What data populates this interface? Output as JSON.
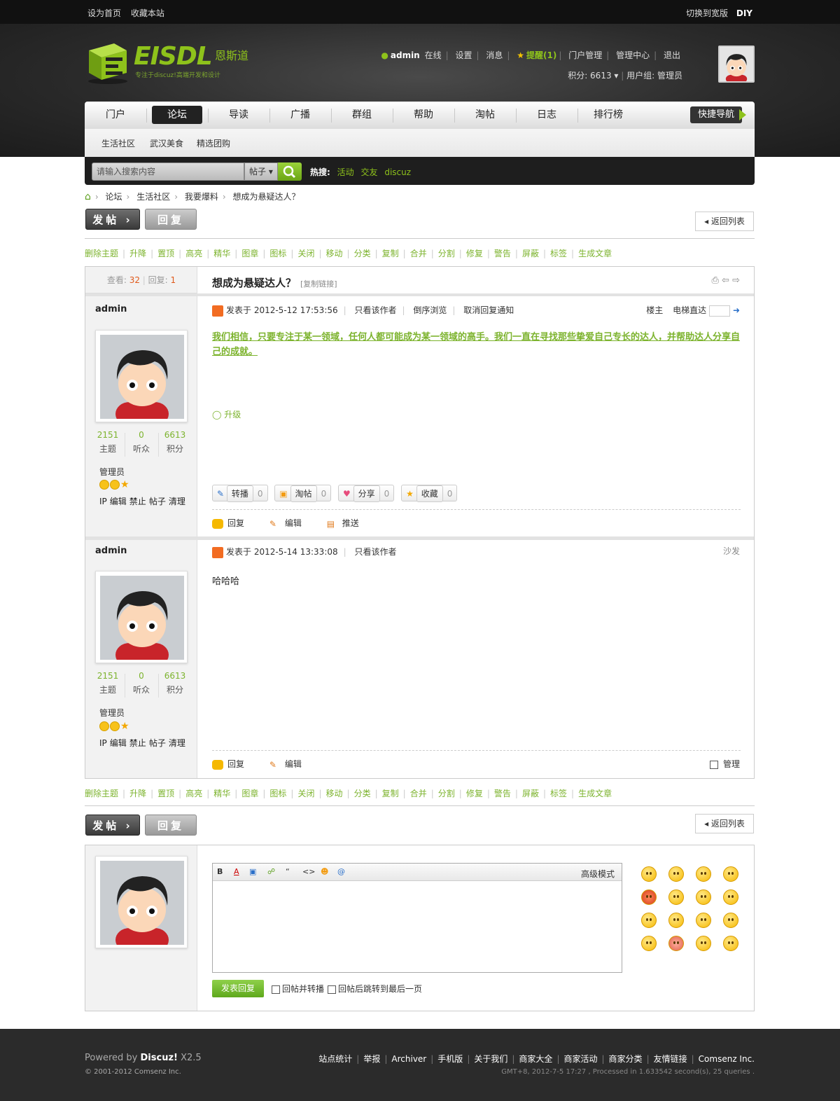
{
  "topbar": {
    "set_home": "设为首页",
    "favorite": "收藏本站",
    "switch_width": "切换到宽版",
    "diy": "DIY"
  },
  "brand": {
    "name": "EISDL",
    "cn_name": "恩斯道",
    "tagline": "专注于discuz!高端开发和设计",
    "accent": "#8ec21b"
  },
  "user": {
    "name": "admin",
    "online": "在线",
    "settings": "设置",
    "messages": "消息",
    "remind": "提醒(1)",
    "portal_manage": "门户管理",
    "admin_center": "管理中心",
    "logout": "退出",
    "credits_label": "积分: 6613",
    "group_label": "用户组: 管理员"
  },
  "nav": {
    "items": [
      "门户",
      "论坛",
      "导读",
      "广播",
      "群组",
      "帮助",
      "淘帖",
      "日志",
      "排行榜"
    ],
    "active": "论坛",
    "quick": "快捷导航"
  },
  "subnav": [
    "生活社区",
    "武汉美食",
    "精选团购"
  ],
  "search": {
    "placeholder": "请输入搜索内容",
    "type": "帖子",
    "hot_label": "热搜:",
    "hot": [
      "活动",
      "交友",
      "discuz"
    ]
  },
  "breadcrumb": [
    "论坛",
    "生活社区",
    "我要爆料",
    "想成为悬疑达人？"
  ],
  "actions": {
    "post": "发帖",
    "reply": "回复",
    "back": "返回列表"
  },
  "modbar": [
    "删除主题",
    "升降",
    "置顶",
    "高亮",
    "精华",
    "图章",
    "图标",
    "关闭",
    "移动",
    "分类",
    "复制",
    "合并",
    "分割",
    "修复",
    "警告",
    "屏蔽",
    "标签",
    "生成文章"
  ],
  "thread": {
    "views_label": "查看:",
    "views": "32",
    "replies_label": "回复:",
    "replies": "1",
    "title": "想成为悬疑达人？",
    "copy_link": "[复制链接]"
  },
  "posts": [
    {
      "author": "admin",
      "stats": [
        {
          "v": "2151",
          "k": "主题"
        },
        {
          "v": "0",
          "k": "听众"
        },
        {
          "v": "6613",
          "k": "积分"
        }
      ],
      "group": "管理员",
      "user_ops": [
        "IP",
        "编辑",
        "禁止",
        "帖子",
        "清理"
      ],
      "posted": "发表于 2012-5-12 17:53:56",
      "only_author": "只看该作者",
      "reverse": "倒序浏览",
      "cancel_notify": "取消回复通知",
      "floor": "楼主",
      "goto": "电梯直达",
      "content": "我们相信，只要专注于某一领域，任何人都可能成为某一领域的高手。我们一直在寻找那些挚爱自己专长的达人，并帮助达人分享自己的成就。",
      "tag": "升级",
      "share": [
        {
          "l": "转播",
          "n": "0"
        },
        {
          "l": "淘帖",
          "n": "0"
        },
        {
          "l": "分享",
          "n": "0"
        },
        {
          "l": "收藏",
          "n": "0"
        }
      ],
      "ops": [
        "回复",
        "编辑",
        "推送"
      ]
    },
    {
      "author": "admin",
      "stats": [
        {
          "v": "2151",
          "k": "主题"
        },
        {
          "v": "0",
          "k": "听众"
        },
        {
          "v": "6613",
          "k": "积分"
        }
      ],
      "group": "管理员",
      "user_ops": [
        "IP",
        "编辑",
        "禁止",
        "帖子",
        "清理"
      ],
      "posted": "发表于 2012-5-14 13:33:08",
      "only_author": "只看该作者",
      "floor": "沙发",
      "content": "哈哈哈",
      "ops": [
        "回复",
        "编辑"
      ],
      "manage": "管理"
    }
  ],
  "editor": {
    "advanced": "高级模式",
    "submit": "发表回复",
    "opt1": "回帖并转播",
    "opt2": "回帖后跳转到最后一页"
  },
  "footer": {
    "powered": "Powered by",
    "product": "Discuz!",
    "version": "X2.5",
    "copyright": "© 2001-2012 Comsenz Inc.",
    "links": [
      "站点统计",
      "举报",
      "Archiver",
      "手机版",
      "关于我们",
      "商家大全",
      "商家活动",
      "商家分类",
      "友情链接",
      "Comsenz Inc."
    ],
    "info": "GMT+8, 2012-7-5 17:27 , Processed in 1.633542 second(s), 25 queries ."
  }
}
